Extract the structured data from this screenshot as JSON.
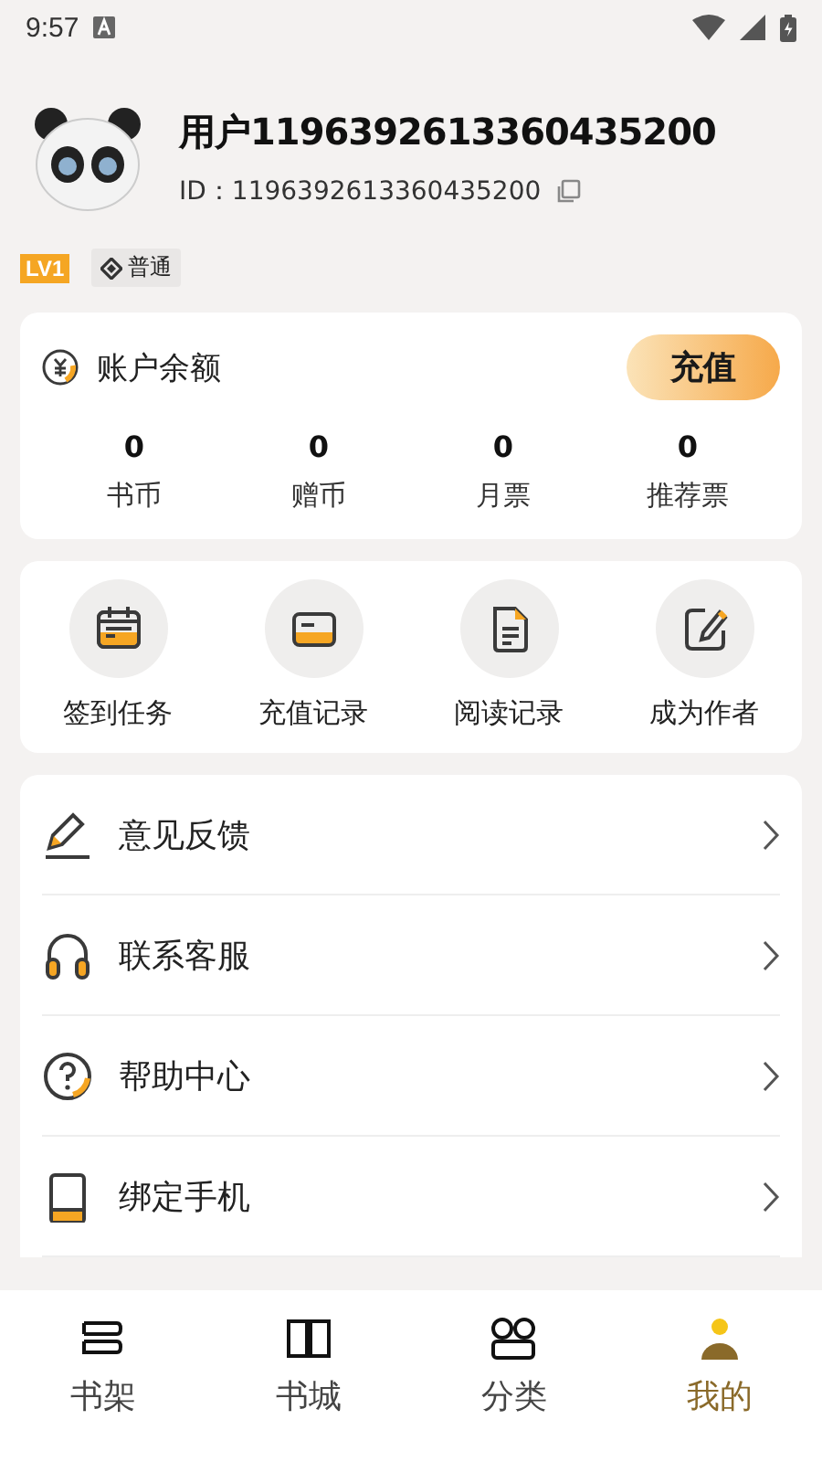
{
  "status_bar": {
    "time": "9:57"
  },
  "profile": {
    "name": "用户1196392613360435200",
    "id_label": "ID：1196392613360435200",
    "level": "LV1",
    "tier": "普通"
  },
  "balance": {
    "title": "账户余额",
    "recharge_button": "充值",
    "stats": [
      {
        "value": "0",
        "label": "书币"
      },
      {
        "value": "0",
        "label": "赠币"
      },
      {
        "value": "0",
        "label": "月票"
      },
      {
        "value": "0",
        "label": "推荐票"
      }
    ]
  },
  "shortcuts": [
    {
      "kind": "calendar",
      "label": "签到任务"
    },
    {
      "kind": "card",
      "label": "充值记录"
    },
    {
      "kind": "document",
      "label": "阅读记录"
    },
    {
      "kind": "edit",
      "label": "成为作者"
    }
  ],
  "menu": [
    {
      "kind": "pencil",
      "label": "意见反馈"
    },
    {
      "kind": "headphones",
      "label": "联系客服"
    },
    {
      "kind": "help",
      "label": "帮助中心"
    },
    {
      "kind": "phone",
      "label": "绑定手机"
    }
  ],
  "bottom_nav": [
    {
      "kind": "shelf",
      "label": "书架",
      "selected": false
    },
    {
      "kind": "store",
      "label": "书城",
      "selected": false
    },
    {
      "kind": "category",
      "label": "分类",
      "selected": false
    },
    {
      "kind": "profile",
      "label": "我的",
      "selected": true
    }
  ]
}
